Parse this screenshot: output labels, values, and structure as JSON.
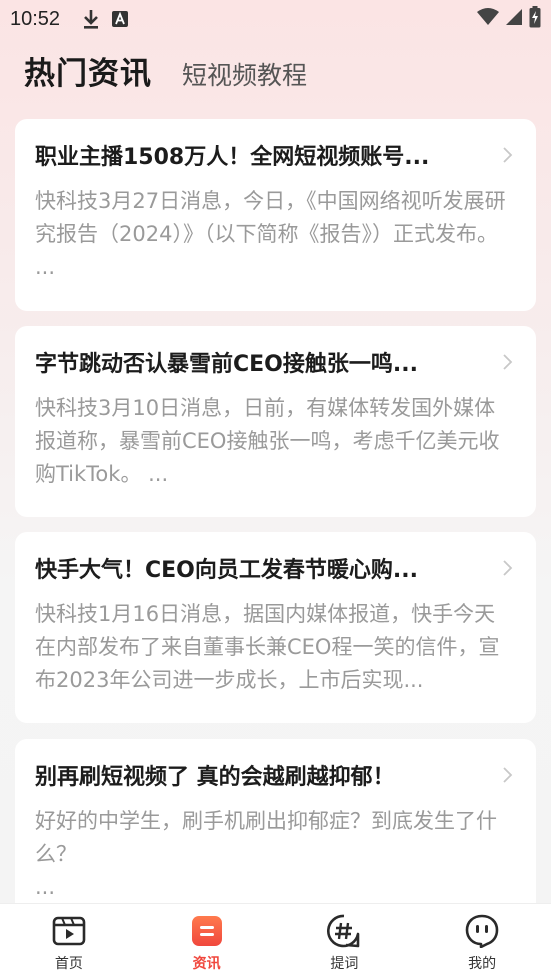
{
  "status_bar": {
    "time": "10:52",
    "left_icons": [
      "download-icon",
      "a-icon"
    ],
    "right_icons": [
      "wifi-icon",
      "signal-icon",
      "battery-charging-icon"
    ]
  },
  "header": {
    "title": "热门资讯",
    "subtitle": "短视频教程"
  },
  "articles": [
    {
      "title": "职业主播1508万人！全网短视频账号...",
      "description": "快科技3月27日消息，今日，《中国网络视听发展研究报告（2024）》（以下简称《报告》）正式发布。 ..."
    },
    {
      "title": "字节跳动否认暴雪前CEO接触张一鸣...",
      "description": "快科技3月10日消息，日前，有媒体转发国外媒体报道称，暴雪前CEO接触张一鸣，考虑千亿美元收购TikTok。 ..."
    },
    {
      "title": "快手大气！CEO向员工发春节暖心购...",
      "description": "快科技1月16日消息，据国内媒体报道，快手今天在内部发布了来自董事长兼CEO程一笑的信件，宣布2023年公司进一步成长，上市后实现..."
    },
    {
      "title": "别再刷短视频了 真的会越刷越抑郁！",
      "description": "好好的中学生，刷手机刷出抑郁症？到底发生了什么？",
      "ellipsis": "..."
    }
  ],
  "bottom_nav": [
    {
      "label": "首页",
      "icon": "video-icon",
      "active": false
    },
    {
      "label": "资讯",
      "icon": "news-icon",
      "active": true
    },
    {
      "label": "提词",
      "icon": "hashtag-icon",
      "active": false
    },
    {
      "label": "我的",
      "icon": "face-icon",
      "active": false
    }
  ],
  "colors": {
    "accent": "#f0473d",
    "title_text": "#1c1c1c",
    "desc_text": "#9a9a9a"
  }
}
